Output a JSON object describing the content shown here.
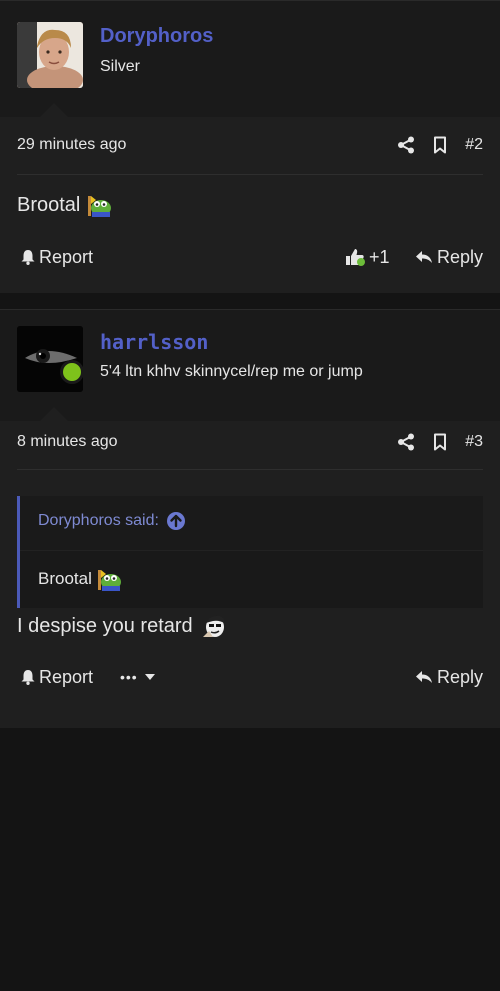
{
  "colors": {
    "accent": "#5360c8",
    "online": "#7ec21b",
    "background": "#1f1f1f"
  },
  "posts": [
    {
      "username": "Doryphoros",
      "user_title": "Silver",
      "time": "29 minutes ago",
      "number": "#2",
      "content": "Brootal",
      "content_emoji": "frog-emoji",
      "report_label": "Report",
      "reaction_count": "+1",
      "reply_label": "Reply"
    },
    {
      "username": "harrlsson",
      "user_title": "5'4 ltn khhv skinnycel/rep me or jump",
      "time": "8 minutes ago",
      "number": "#3",
      "quote": {
        "attribution": "Doryphoros said:",
        "text": "Brootal"
      },
      "content": "I despise you retard",
      "content_emoji": "dude-emoji",
      "report_label": "Report",
      "more_label": "•••",
      "reply_label": "Reply"
    }
  ]
}
